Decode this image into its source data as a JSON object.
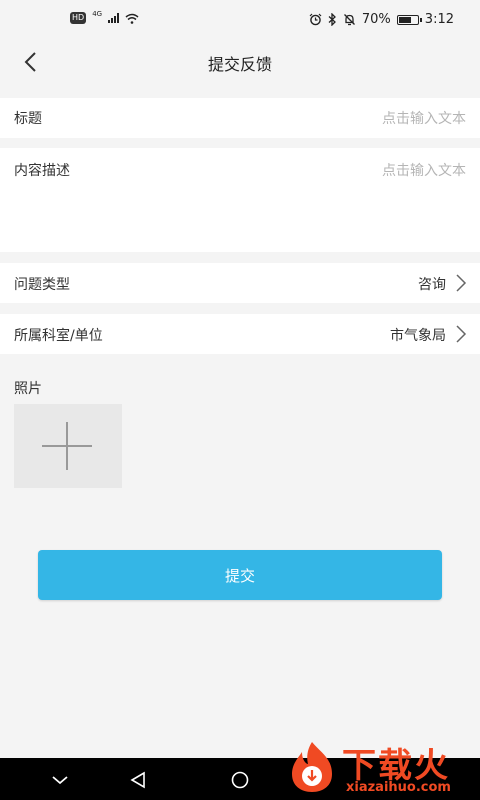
{
  "status_bar": {
    "hd": "HD",
    "network": "4G",
    "battery": "70%",
    "battery_level": 0.7,
    "time": "3:12",
    "icons": [
      "signal-icon",
      "wifi-icon",
      "alarm-icon",
      "bluetooth-icon",
      "mute-icon",
      "battery-icon"
    ]
  },
  "header": {
    "title": "提交反馈"
  },
  "form": {
    "title_label": "标题",
    "title_placeholder": "点击输入文本",
    "content_label": "内容描述",
    "content_placeholder": "点击输入文本",
    "type_label": "问题类型",
    "type_value": "咨询",
    "dept_label": "所属科室/单位",
    "dept_value": "市气象局",
    "photo_label": "照片"
  },
  "submit_label": "提交",
  "watermark": {
    "text": "下载火",
    "url": "xiazaihuo.com"
  },
  "colors": {
    "accent": "#34b6e6",
    "watermark": "#f04a23",
    "background": "#f4f4f4"
  }
}
